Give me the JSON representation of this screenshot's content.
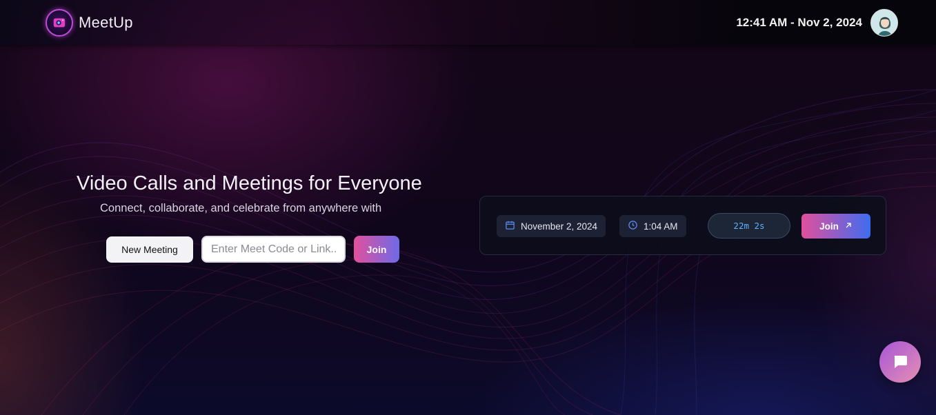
{
  "app": {
    "name": "MeetUp",
    "logo_icon": "camera-icon",
    "current_datetime": "12:41 AM - Nov 2, 2024",
    "avatar_icon": "user-avatar"
  },
  "hero": {
    "title": "Video Calls and Meetings for Everyone",
    "subtitle": "Connect, collaborate, and celebrate from anywhere with",
    "new_meeting_label": "New Meeting",
    "code_input_placeholder": "Enter Meet Code or Link...",
    "code_input_value": "",
    "join_label": "Join"
  },
  "upcoming_meeting": {
    "date_icon": "calendar-icon",
    "date": "November 2, 2024",
    "time_icon": "clock-icon",
    "time": "1:04 AM",
    "countdown": "22m 2s",
    "join_label": "Join",
    "join_icon": "arrow-up-right-icon"
  },
  "chat": {
    "icon": "chat-bubble-icon"
  },
  "colors": {
    "accent_pink": "#e2509c",
    "accent_blue": "#3f6cf0",
    "countdown_text": "#5eb0ff",
    "background": "#10061b"
  }
}
